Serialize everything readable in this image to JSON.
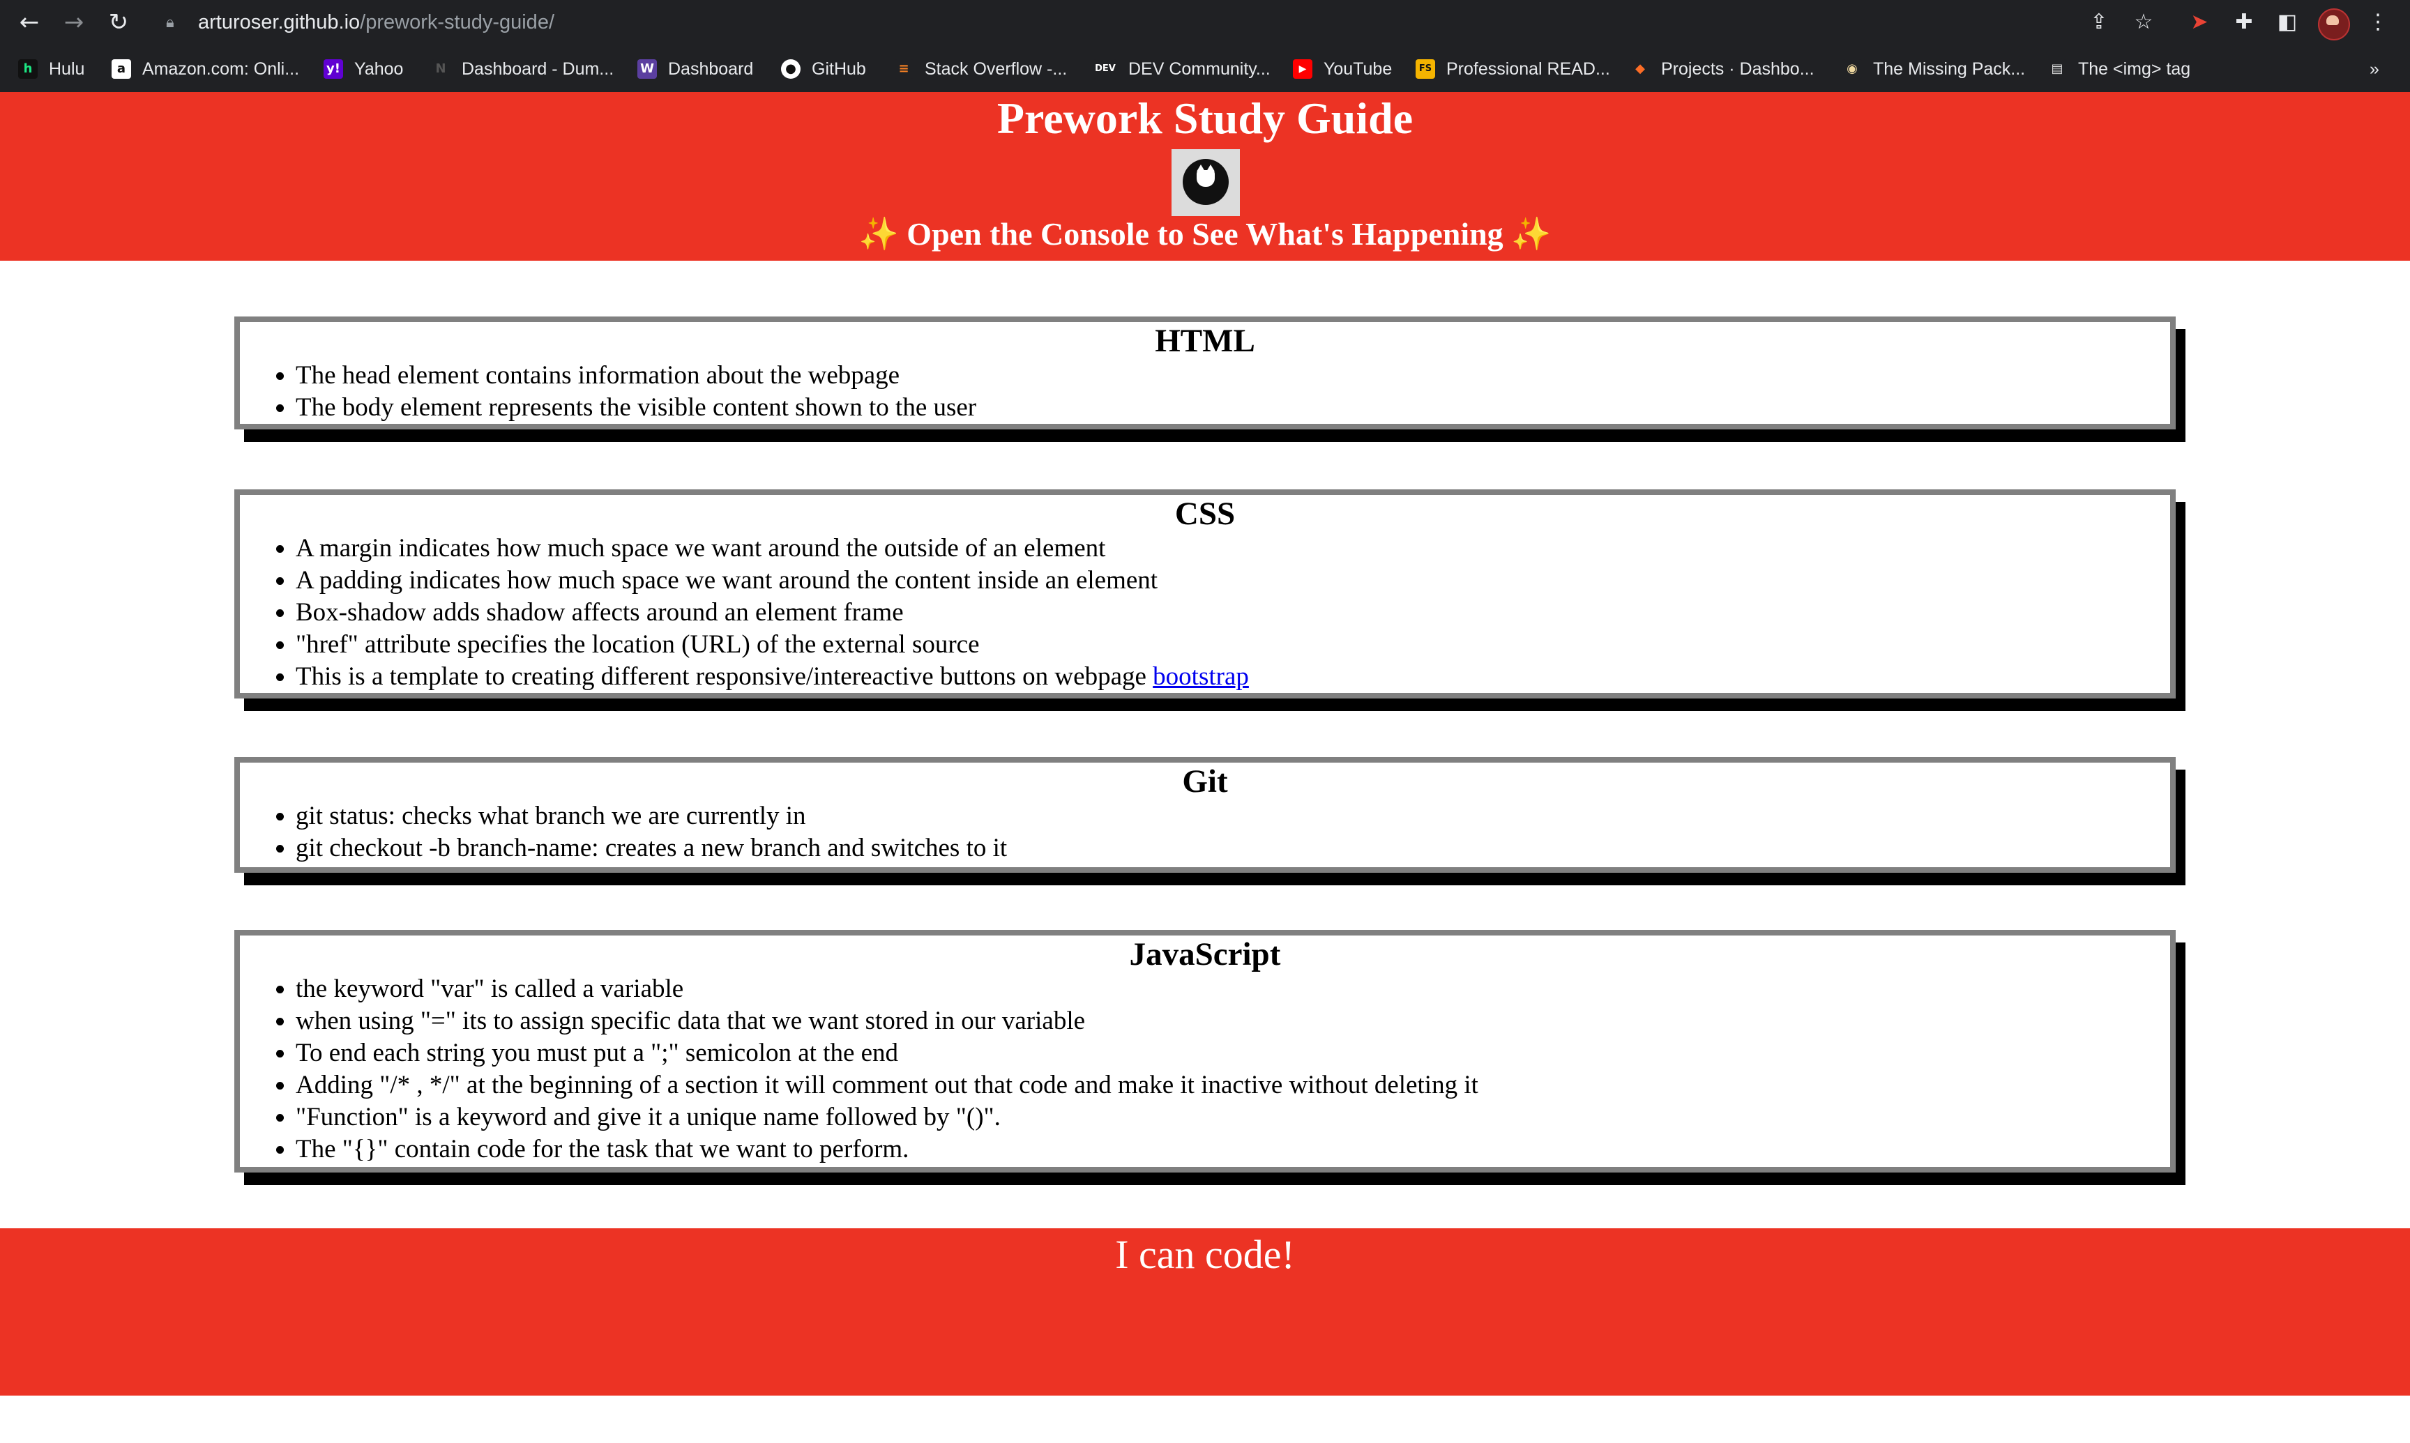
{
  "browser": {
    "url_host": "arturoser.github.io",
    "url_path": "/prework-study-guide/",
    "bookmarks": [
      {
        "label": "Hulu",
        "icon": "hulu-icon"
      },
      {
        "label": "Amazon.com: Onli...",
        "icon": "amazon-icon"
      },
      {
        "label": "Yahoo",
        "icon": "yahoo-icon"
      },
      {
        "label": "Dashboard - Dum...",
        "icon": "dashboard-icon"
      },
      {
        "label": "Dashboard",
        "icon": "w-dashboard-icon"
      },
      {
        "label": "GitHub",
        "icon": "github-icon"
      },
      {
        "label": "Stack Overflow -...",
        "icon": "stackoverflow-icon"
      },
      {
        "label": "DEV Community...",
        "icon": "dev-icon"
      },
      {
        "label": "YouTube",
        "icon": "youtube-icon"
      },
      {
        "label": "Professional READ...",
        "icon": "fs-icon"
      },
      {
        "label": "Projects · Dashbo...",
        "icon": "gitlab-icon"
      },
      {
        "label": "The Missing Pack...",
        "icon": "missing-pack-icon"
      },
      {
        "label": "The <img> tag",
        "icon": "img-tag-icon"
      }
    ],
    "more_label": "»"
  },
  "header": {
    "title": "Prework Study Guide",
    "subtitle": "✨ Open the Console to See What's Happening ✨"
  },
  "sections": {
    "html": {
      "heading": "HTML",
      "items": [
        "The head element contains information about the webpage",
        "The body element represents the visible content shown to the user"
      ]
    },
    "css": {
      "heading": "CSS",
      "items": [
        "A margin indicates how much space we want around the outside of an element",
        "A padding indicates how much space we want around the content inside an element",
        "Box-shadow adds shadow affects around an element frame",
        "\"href\" attribute specifies the location (URL) of the external source",
        "This is a template to creating different responsive/intereactive buttons on webpage "
      ],
      "link_text": "bootstrap"
    },
    "git": {
      "heading": "Git",
      "items": [
        "git status: checks what branch we are currently in",
        "git checkout -b branch-name: creates a new branch and switches to it"
      ]
    },
    "javascript": {
      "heading": "JavaScript",
      "items": [
        "the keyword \"var\" is called a variable",
        "when using \"=\" its to assign specific data that we want stored in our variable",
        "To end each string you must put a \";\" semicolon at the end",
        "Adding \"/* , */\" at the beginning of a section it will comment out that code and make it inactive without deleting it",
        "\"Function\" is a keyword and give it a unique name followed by \"()\".",
        "The \"{}\" contain code for the task that we want to perform."
      ]
    }
  },
  "footer": {
    "text": "I can code!"
  },
  "colors": {
    "accent_red": "#ec3324",
    "card_border": "#808080",
    "link": "#0000ee"
  }
}
